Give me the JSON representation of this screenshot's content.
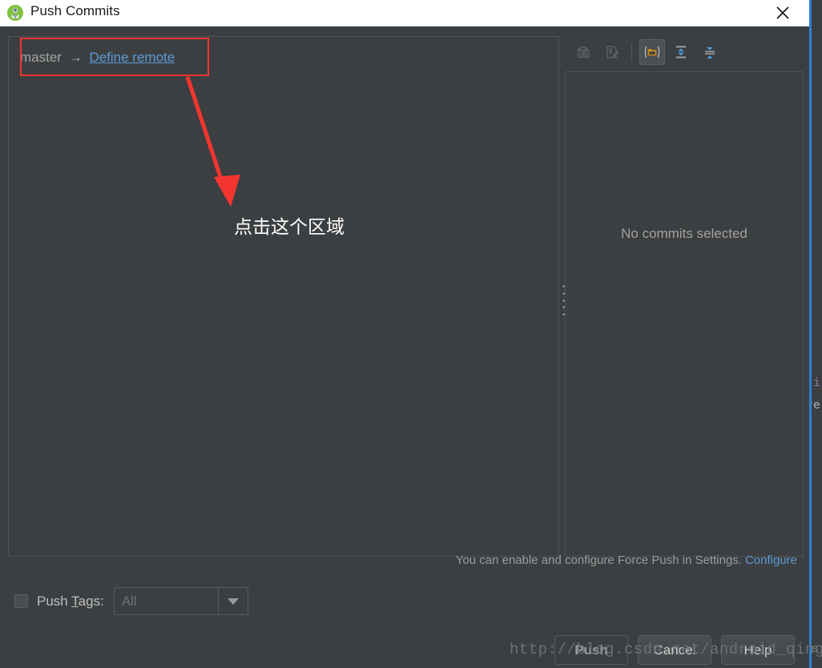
{
  "window": {
    "title": "Push Commits",
    "app_icon": "android-studio-icon",
    "close_icon": "close-icon",
    "border_color": "#2f7fd0"
  },
  "commits_panel": {
    "branch": "master",
    "arrow": "→",
    "define_remote_link": "Define remote",
    "link_color": "#5c9ad6"
  },
  "diff_panel": {
    "toolbar": [
      {
        "name": "revert-icon",
        "state": "disabled",
        "tooltip": "Revert"
      },
      {
        "name": "annotate-icon",
        "state": "disabled",
        "tooltip": "Annotate"
      },
      {
        "name": "folder-view-icon",
        "state": "selected",
        "tooltip": "Group by directory"
      },
      {
        "name": "expand-all-icon",
        "state": "enabled",
        "tooltip": "Expand All"
      },
      {
        "name": "collapse-all-icon",
        "state": "enabled",
        "tooltip": "Collapse All"
      }
    ],
    "empty_message": "No commits selected"
  },
  "force_push_hint": {
    "text": "You can enable and configure Force Push in Settings.",
    "link": "Configure"
  },
  "push_tags": {
    "checked": false,
    "label_prefix": "Push ",
    "label_mnemonic": "T",
    "label_suffix": "ags:",
    "combo_value": "All",
    "combo_arrow_icon": "chevron-down-icon"
  },
  "buttons": {
    "push": "Push",
    "cancel": "Cancel",
    "help": "Help"
  },
  "watermark": {
    "text": "http://blog.csdn.net/android_qinglong"
  },
  "annotations": {
    "highlight_box_color": "#f4352f",
    "arrow_color": "#f4352f",
    "callout_text": "点击这个区域"
  },
  "background": {
    "code_fragment_1": ";i",
    "code_fragment_2": "re",
    "code_fragment_3": "s"
  }
}
